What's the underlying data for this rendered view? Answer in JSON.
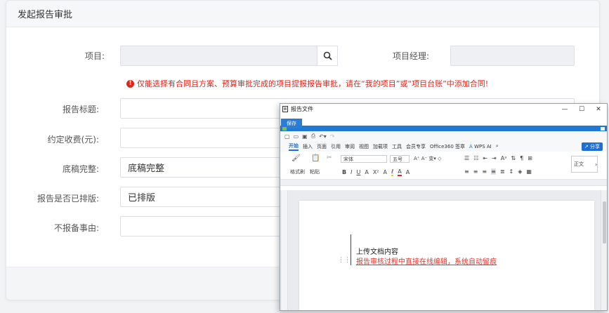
{
  "card": {
    "title": "发起报告审批"
  },
  "form": {
    "project_label": "项目:",
    "project_value": "",
    "manager_label": "项目经理:",
    "manager_value": "",
    "warning": "仅能选择有合同且方案、预算审批完成的项目提报报告审批，请在“我的项目”或“项目台账”中添加合同!",
    "report_title_label": "报告标题:",
    "fee_label": "约定收费(元):",
    "draft_label": "底稿完整:",
    "draft_value": "底稿完整",
    "typeset_label": "报告是否已排版:",
    "typeset_value": "已排版",
    "reason_label": "不报备事由:"
  },
  "wps": {
    "title": "报告文件",
    "save": "保存",
    "tabs": [
      "开始",
      "插入",
      "页面",
      "引用",
      "审阅",
      "视图",
      "加载项",
      "工具",
      "会员专享",
      "Office360 签章",
      "WPS AI"
    ],
    "share": "分享",
    "format_painter": "格式刷",
    "paste": "粘贴",
    "font": "宋体",
    "size": "五号",
    "style": "正文",
    "doc_line1": "上传文档内容",
    "doc_line2": "报告审核过程中直接在线编辑，系统自动留痕"
  },
  "colors": {
    "accent": "#1f6ed4",
    "warning": "#e1251b",
    "tracked_change": "#e8332b"
  }
}
